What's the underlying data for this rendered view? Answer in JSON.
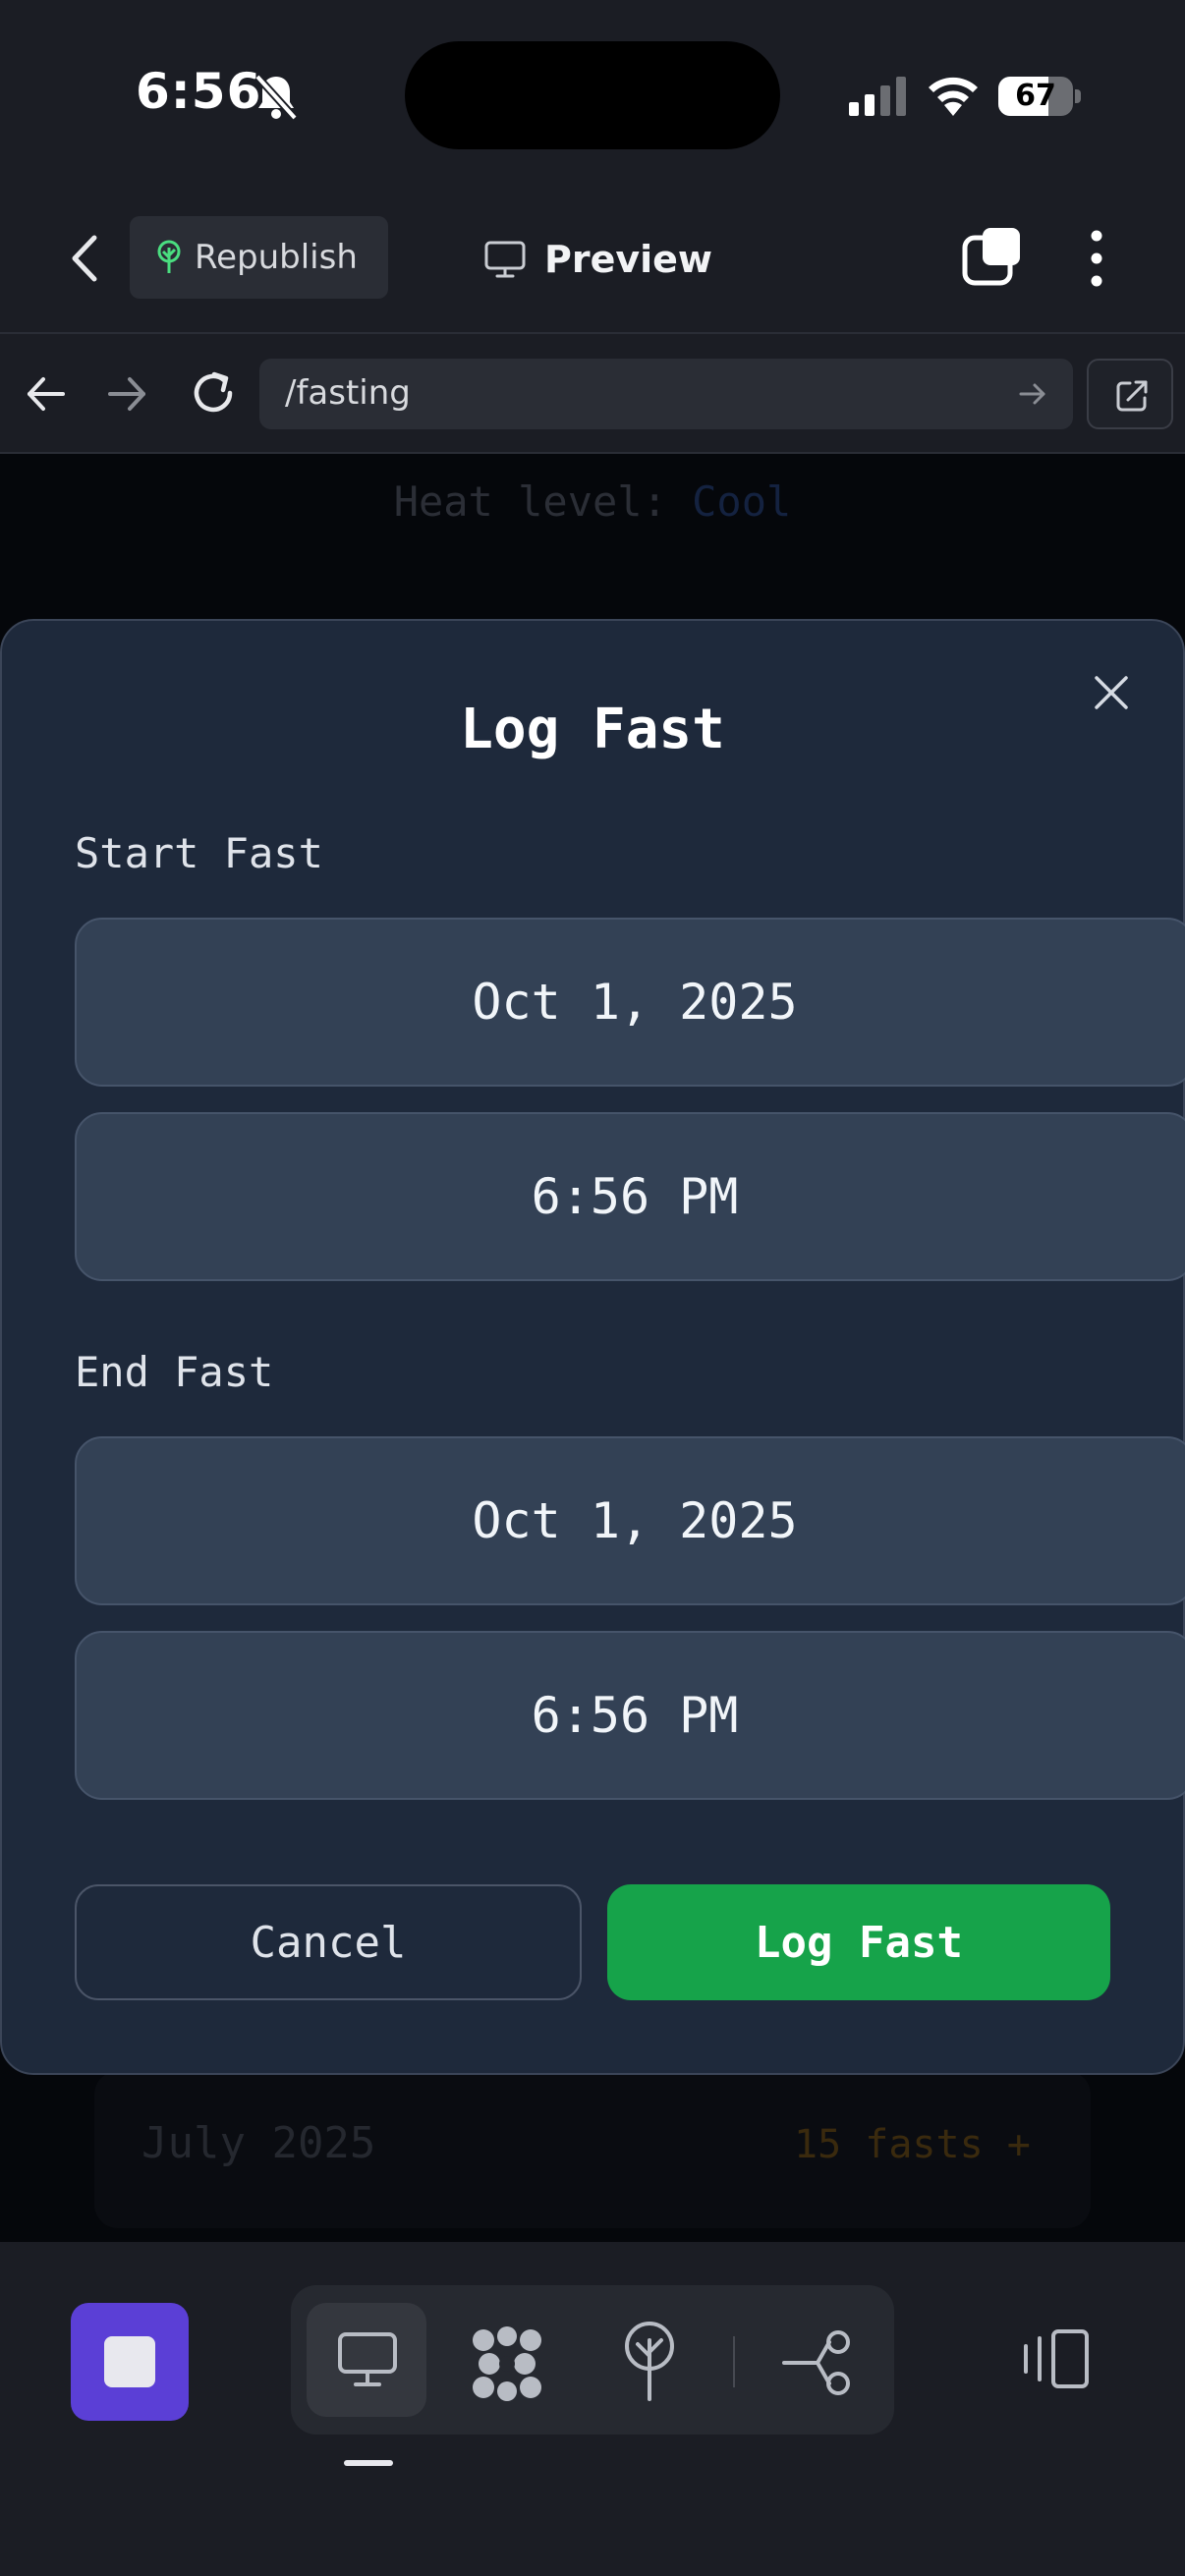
{
  "status_bar": {
    "time": "6:56",
    "battery_percent": 67,
    "battery_label": "67",
    "icons": [
      "bell-slash-icon",
      "cellular-signal-icon",
      "wifi-icon",
      "battery-icon"
    ]
  },
  "header": {
    "republish_label": "Republish",
    "preview_label": "Preview",
    "icons": [
      "chevron-left-icon",
      "tree-icon",
      "monitor-icon",
      "tabs-icon",
      "more-vertical-icon"
    ]
  },
  "browser": {
    "url": "/fasting",
    "icons": [
      "arrow-left-icon",
      "arrow-right-icon",
      "reload-icon",
      "go-arrow-icon",
      "open-external-icon"
    ]
  },
  "background_page": {
    "heat_prefix": "Heat level: ",
    "heat_value": "Cool",
    "month_label": "July 2025",
    "month_count": "15 fasts +"
  },
  "modal": {
    "title": "Log Fast",
    "start_label": "Start Fast",
    "start_date": "Oct 1, 2025",
    "start_time": "6:56 PM",
    "end_label": "End Fast",
    "end_date": "Oct 1, 2025",
    "end_time": "6:56 PM",
    "cancel_label": "Cancel",
    "submit_label": "Log Fast"
  },
  "bottom_bar": {
    "icons": [
      "stop-icon",
      "desktop-icon",
      "agents-icon",
      "deploy-icon",
      "connect-icon",
      "dock-icon"
    ]
  },
  "colors": {
    "modal_bg": "#1e293b",
    "field_bg": "#334155",
    "submit_green": "#16a34a",
    "stop_purple": "#5b3fd6"
  }
}
